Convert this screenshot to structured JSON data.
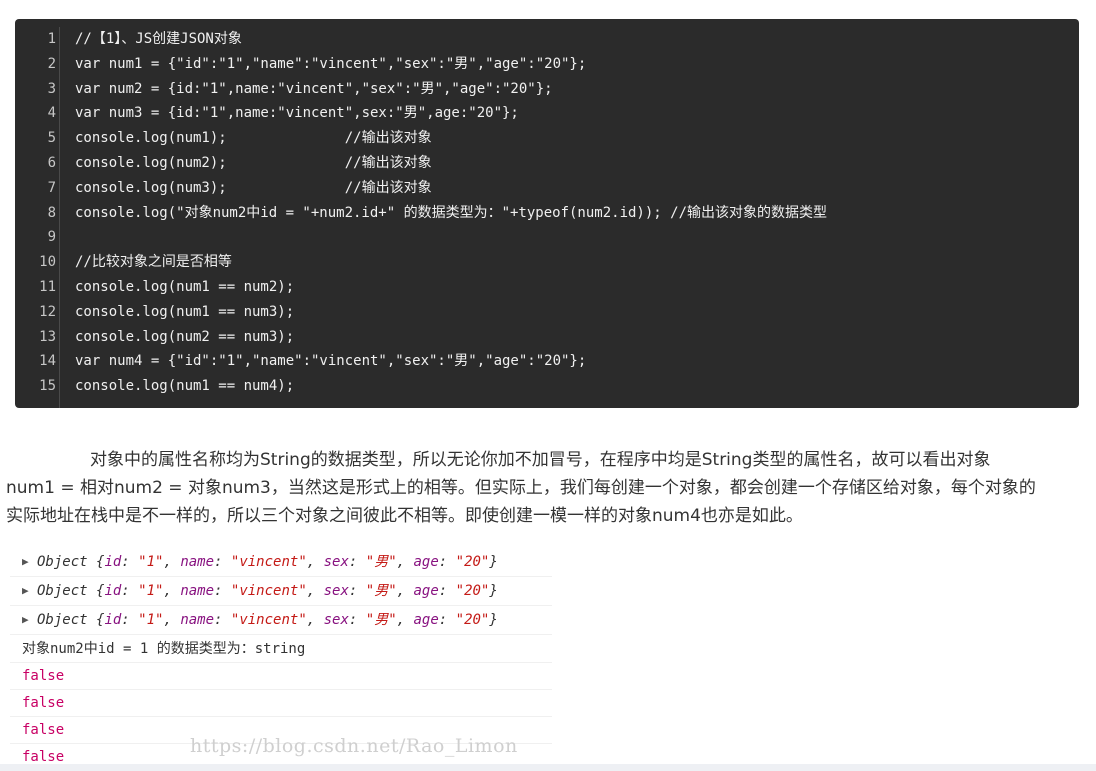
{
  "code": {
    "lines": [
      {
        "n": "1",
        "text": "//【1】、JS创建JSON对象"
      },
      {
        "n": "2",
        "text": "var num1 = {\"id\":\"1\",\"name\":\"vincent\",\"sex\":\"男\",\"age\":\"20\"};"
      },
      {
        "n": "3",
        "text": "var num2 = {id:\"1\",name:\"vincent\",\"sex\":\"男\",\"age\":\"20\"};"
      },
      {
        "n": "4",
        "text": "var num3 = {id:\"1\",name:\"vincent\",sex:\"男\",age:\"20\"};"
      },
      {
        "n": "5",
        "text": "console.log(num1);              //输出该对象"
      },
      {
        "n": "6",
        "text": "console.log(num2);              //输出该对象"
      },
      {
        "n": "7",
        "text": "console.log(num3);              //输出该对象"
      },
      {
        "n": "8",
        "text": "console.log(\"对象num2中id = \"+num2.id+\" 的数据类型为：\"+typeof(num2.id)); //输出该对象的数据类型"
      },
      {
        "n": "9",
        "text": ""
      },
      {
        "n": "10",
        "text": "//比较对象之间是否相等"
      },
      {
        "n": "11",
        "text": "console.log(num1 == num2);"
      },
      {
        "n": "12",
        "text": "console.log(num1 == num3);"
      },
      {
        "n": "13",
        "text": "console.log(num2 == num3);"
      },
      {
        "n": "14",
        "text": "var num4 = {\"id\":\"1\",\"name\":\"vincent\",\"sex\":\"男\",\"age\":\"20\"};"
      },
      {
        "n": "15",
        "text": "console.log(num1 == num4);"
      }
    ]
  },
  "paragraph": {
    "line1": "对象中的属性名称均为String的数据类型，所以无论你加不加冒号，在程序中均是String类型的属性名，故可以看出对象",
    "line2": "num1 = 相对num2 = 对象num3，当然这是形式上的相等。但实际上，我们每创建一个对象，都会创建一个存储区给对象，每个对象的",
    "line3": "实际地址在栈中是不一样的，所以三个对象之间彼此不相等。即使创建一模一样的对象num4也亦是如此。"
  },
  "console": {
    "arrow": "▶",
    "objects": [
      {
        "prefix": "Object {",
        "k1": "id",
        "v1": "\"1\"",
        "k2": "name",
        "v2": "\"vincent\"",
        "k3": "sex",
        "v3": "\"男\"",
        "k4": "age",
        "v4": "\"20\"",
        "suffix": "}"
      },
      {
        "prefix": "Object {",
        "k1": "id",
        "v1": "\"1\"",
        "k2": "name",
        "v2": "\"vincent\"",
        "k3": "sex",
        "v3": "\"男\"",
        "k4": "age",
        "v4": "\"20\"",
        "suffix": "}"
      },
      {
        "prefix": "Object {",
        "k1": "id",
        "v1": "\"1\"",
        "k2": "name",
        "v2": "\"vincent\"",
        "k3": "sex",
        "v3": "\"男\"",
        "k4": "age",
        "v4": "\"20\"",
        "suffix": "}"
      }
    ],
    "type_line": "对象num2中id = 1 的数据类型为：string",
    "results": [
      "false",
      "false",
      "false",
      "false"
    ]
  },
  "watermark": "https://blog.csdn.net/Rao_Limon",
  "colors": {
    "code_bg": "#2b2b2b",
    "console_key": "#881280",
    "console_string": "#c41a16",
    "console_false": "#c80064"
  }
}
